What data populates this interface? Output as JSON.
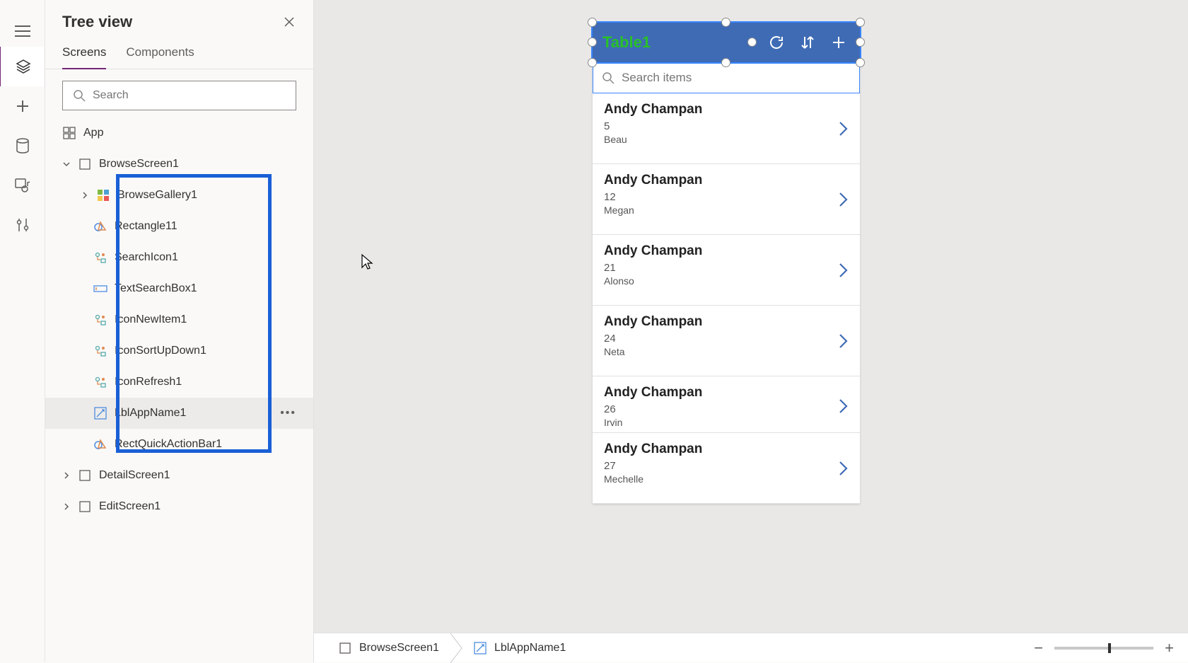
{
  "panel": {
    "title": "Tree view",
    "tabs": {
      "screens": "Screens",
      "components": "Components"
    },
    "search_placeholder": "Search",
    "app_label": "App",
    "nodes": {
      "browseScreen": "BrowseScreen1",
      "browseGallery": "BrowseGallery1",
      "rectangle11": "Rectangle11",
      "searchIcon1": "SearchIcon1",
      "textSearchBox1": "TextSearchBox1",
      "iconNewItem1": "IconNewItem1",
      "iconSortUpDown1": "IconSortUpDown1",
      "iconRefresh1": "IconRefresh1",
      "lblAppName1": "LblAppName1",
      "rectQuickActionBar1": "RectQuickActionBar1",
      "detailScreen1": "DetailScreen1",
      "editScreen1": "EditScreen1"
    }
  },
  "phone": {
    "title": "Table1",
    "search_placeholder": "Search items",
    "items": [
      {
        "name": "Andy Champan",
        "num": "5",
        "sub": "Beau"
      },
      {
        "name": "Andy Champan",
        "num": "12",
        "sub": "Megan"
      },
      {
        "name": "Andy Champan",
        "num": "21",
        "sub": "Alonso"
      },
      {
        "name": "Andy Champan",
        "num": "24",
        "sub": "Neta"
      },
      {
        "name": "Andy Champan",
        "num": "26",
        "sub": "Irvin"
      },
      {
        "name": "Andy Champan",
        "num": "27",
        "sub": "Mechelle"
      }
    ]
  },
  "status": {
    "crumb1": "BrowseScreen1",
    "crumb2": "LblAppName1"
  }
}
